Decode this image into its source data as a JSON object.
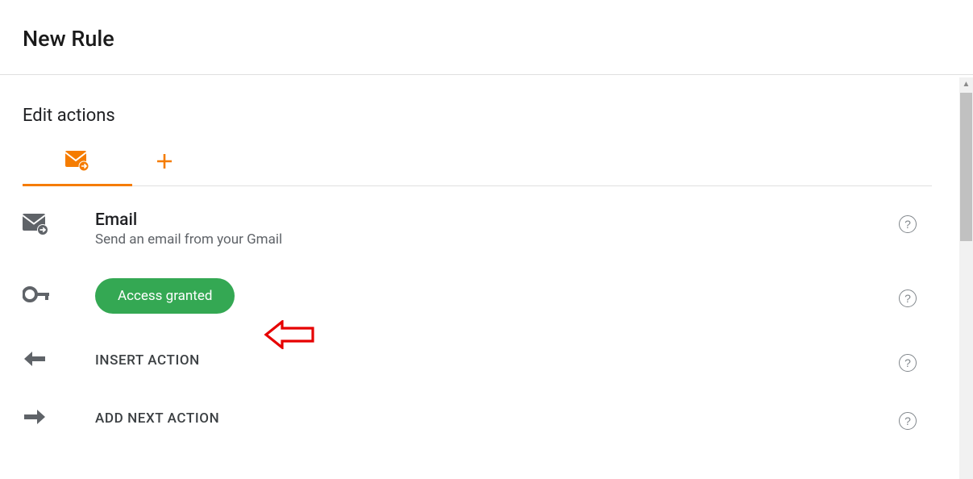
{
  "header": {
    "title": "New Rule"
  },
  "section": {
    "title": "Edit actions"
  },
  "action_email": {
    "title": "Email",
    "subtitle": "Send an email from your Gmail"
  },
  "access": {
    "badge_label": "Access granted"
  },
  "insert_action": {
    "label": "INSERT ACTION"
  },
  "add_next_action": {
    "label": "ADD NEXT ACTION"
  },
  "help": {
    "glyph": "?"
  }
}
